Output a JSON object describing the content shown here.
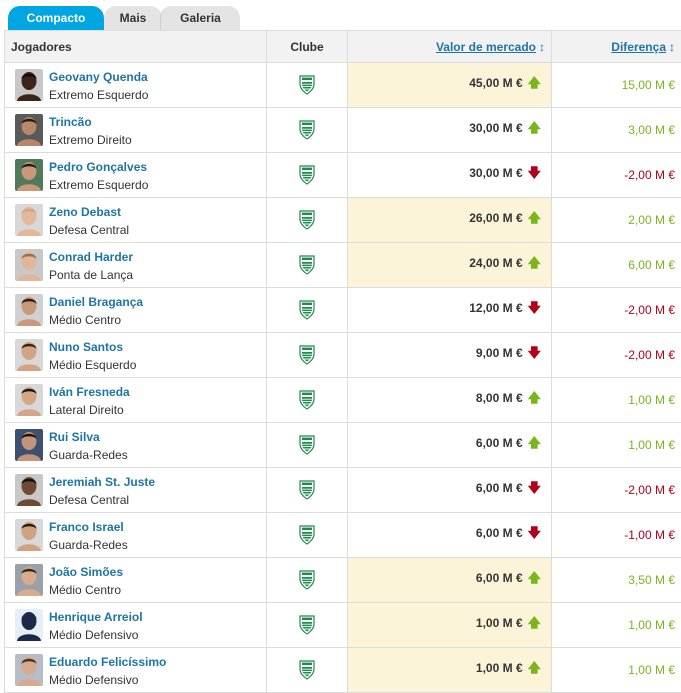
{
  "tabs": [
    {
      "label": "Compacto",
      "active": true
    },
    {
      "label": "Mais",
      "active": false
    },
    {
      "label": "Galeria",
      "active": false
    }
  ],
  "headers": {
    "players": "Jogadores",
    "club": "Clube",
    "market_value": "Valor de mercado",
    "difference": "Diferença",
    "sort_icon": "↕"
  },
  "colors": {
    "positive": "#7ab51d",
    "negative": "#b0001a",
    "up_arrow": "#7ab51d",
    "down_arrow": "#b0001a",
    "highlight": "#fbf4d9",
    "link": "#1d75a3",
    "tab_active": "#00a6e1"
  },
  "players": [
    {
      "name": "Geovany Quenda",
      "position": "Extremo Esquerdo",
      "club_icon": "sporting-crest-icon",
      "market_value": "45,00 M €",
      "trend": "up",
      "difference": "15,00 M €",
      "highlight": true,
      "avatar_skin": "#3b2418",
      "avatar_hair": "#120c08",
      "avatar_bg": "#c8c8c8"
    },
    {
      "name": "Trincão",
      "position": "Extremo Direito",
      "club_icon": "sporting-crest-icon",
      "market_value": "30,00 M €",
      "trend": "up",
      "difference": "3,00 M €",
      "highlight": false,
      "avatar_skin": "#b7876a",
      "avatar_hair": "#2a1a10",
      "avatar_bg": "#5a5a5a"
    },
    {
      "name": "Pedro Gonçalves",
      "position": "Extremo Esquerdo",
      "club_icon": "sporting-crest-icon",
      "market_value": "30,00 M €",
      "trend": "down",
      "difference": "-2,00 M €",
      "highlight": false,
      "avatar_skin": "#c89878",
      "avatar_hair": "#2a1c12",
      "avatar_bg": "#4f7b5c"
    },
    {
      "name": "Zeno Debast",
      "position": "Defesa Central",
      "club_icon": "sporting-crest-icon",
      "market_value": "26,00 M €",
      "trend": "up",
      "difference": "2,00 M €",
      "highlight": true,
      "avatar_skin": "#e2b89a",
      "avatar_hair": "#c8a888",
      "avatar_bg": "#d8d8d8"
    },
    {
      "name": "Conrad Harder",
      "position": "Ponta de Lança",
      "club_icon": "sporting-crest-icon",
      "market_value": "24,00 M €",
      "trend": "up",
      "difference": "6,00 M €",
      "highlight": true,
      "avatar_skin": "#e0b69a",
      "avatar_hair": "#9a7050",
      "avatar_bg": "#c8c8c8"
    },
    {
      "name": "Daniel Bragança",
      "position": "Médio Centro",
      "club_icon": "sporting-crest-icon",
      "market_value": "12,00 M €",
      "trend": "down",
      "difference": "-2,00 M €",
      "highlight": false,
      "avatar_skin": "#c99a7a",
      "avatar_hair": "#2e1e12",
      "avatar_bg": "#d0d0d0"
    },
    {
      "name": "Nuno Santos",
      "position": "Médio Esquerdo",
      "club_icon": "sporting-crest-icon",
      "market_value": "9,00 M €",
      "trend": "down",
      "difference": "-2,00 M €",
      "highlight": false,
      "avatar_skin": "#d2a486",
      "avatar_hair": "#3a2616",
      "avatar_bg": "#d8d8d8"
    },
    {
      "name": "Iván Fresneda",
      "position": "Lateral Direito",
      "club_icon": "sporting-crest-icon",
      "market_value": "8,00 M €",
      "trend": "up",
      "difference": "1,00 M €",
      "highlight": false,
      "avatar_skin": "#d4a688",
      "avatar_hair": "#1e140c",
      "avatar_bg": "#d8d8d8"
    },
    {
      "name": "Rui Silva",
      "position": "Guarda-Redes",
      "club_icon": "sporting-crest-icon",
      "market_value": "6,00 M €",
      "trend": "up",
      "difference": "1,00 M €",
      "highlight": false,
      "avatar_skin": "#c2957a",
      "avatar_hair": "#1a120c",
      "avatar_bg": "#3e5070"
    },
    {
      "name": "Jeremiah St. Juste",
      "position": "Defesa Central",
      "club_icon": "sporting-crest-icon",
      "market_value": "6,00 M €",
      "trend": "down",
      "difference": "-2,00 M €",
      "highlight": false,
      "avatar_skin": "#6e4a32",
      "avatar_hair": "#1a100a",
      "avatar_bg": "#c8c8c8"
    },
    {
      "name": "Franco Israel",
      "position": "Guarda-Redes",
      "club_icon": "sporting-crest-icon",
      "market_value": "6,00 M €",
      "trend": "down",
      "difference": "-1,00 M €",
      "highlight": false,
      "avatar_skin": "#d0a284",
      "avatar_hair": "#2a1a10",
      "avatar_bg": "#d8d8d8"
    },
    {
      "name": "João Simões",
      "position": "Médio Centro",
      "club_icon": "sporting-crest-icon",
      "market_value": "6,00 M €",
      "trend": "up",
      "difference": "3,50 M €",
      "highlight": true,
      "avatar_skin": "#d8ac8e",
      "avatar_hair": "#3a2818",
      "avatar_bg": "#9aa0a8"
    },
    {
      "name": "Henrique Arreiol",
      "position": "Médio Defensivo",
      "club_icon": "sporting-crest-icon",
      "market_value": "1,00 M €",
      "trend": "up",
      "difference": "1,00 M €",
      "highlight": true,
      "avatar_skin": "#1a2a48",
      "avatar_hair": "#1a2a48",
      "avatar_bg": "#e8eef6"
    },
    {
      "name": "Eduardo Felicíssimo",
      "position": "Médio Defensivo",
      "club_icon": "sporting-crest-icon",
      "market_value": "1,00 M €",
      "trend": "up",
      "difference": "1,00 M €",
      "highlight": true,
      "avatar_skin": "#d6aa8c",
      "avatar_hair": "#4a3420",
      "avatar_bg": "#b8bcc4"
    }
  ]
}
